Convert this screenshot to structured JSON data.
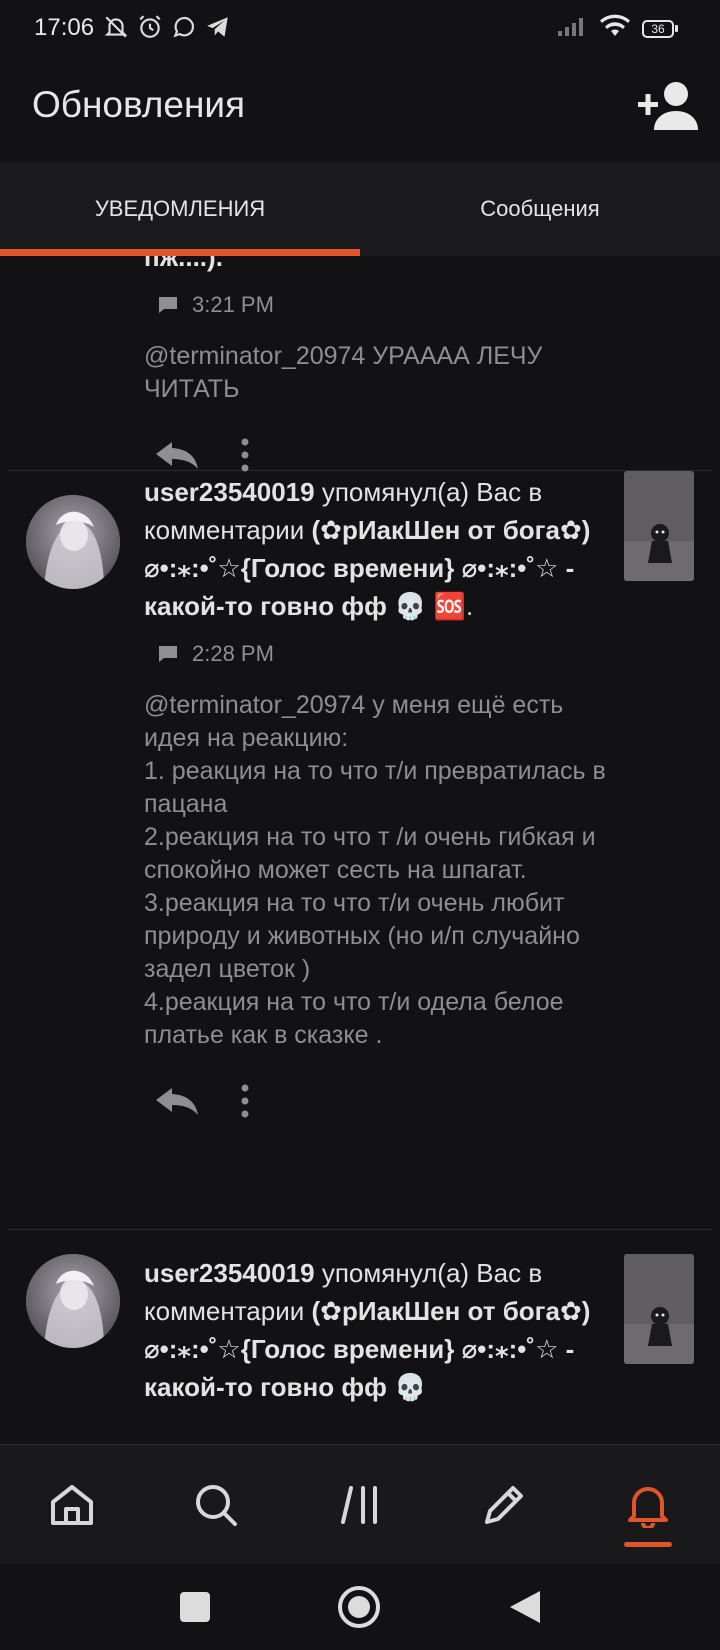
{
  "status_bar": {
    "time": "17:06",
    "battery": "36",
    "icons": [
      "bell-muted-icon",
      "alarm-icon",
      "whatsapp-icon",
      "telegram-icon",
      "signal-icon",
      "wifi-icon",
      "battery-icon"
    ]
  },
  "header": {
    "title": "Обновления",
    "add_user_icon": "add-user-icon"
  },
  "tabs": [
    {
      "label": "УВЕДОМЛЕНИЯ",
      "active": true
    },
    {
      "label": "Сообщения",
      "active": false
    }
  ],
  "colors": {
    "accent": "#e0562a",
    "background": "#121114",
    "text_primary": "#e3e3e3",
    "text_secondary": "#8e8d91"
  },
  "feed": {
    "partial": {
      "title_tail": "пж....).",
      "time": "3:21 PM",
      "comment": "@terminator_20974 УРАААА ЛЕЧУ ЧИТАТЬ"
    },
    "items": [
      {
        "user": "user23540019",
        "action": "упомянул(а) Вас в комментарии",
        "work": "(✿рИакШен от бога✿) ⌀•:⁎:•˚☆{Голос времени} ⌀•:⁎:•˚☆ - какой-то говно фф 💀 🆘",
        "end": ".",
        "time": "2:28 PM",
        "comment": "@terminator_20974 у меня ещё есть идея на реакцию:\n1. реакция на то что т/и превратилась в пацана\n2.реакция на то что т /и очень гибкая и спокойно может сесть на шпагат.\n3.реакция на то что т/и очень любит природу и животных (но и/п случайно задел цветок )\n4.реакция на то что т/и одела белое платье как в сказке ."
      },
      {
        "user": "user23540019",
        "action": "упомянул(а) Вас в комментарии",
        "work": "(✿рИакШен от бога✿) ⌀•:⁎:•˚☆{Голос времени} ⌀•:⁎:•˚☆ - какой-то говно фф 💀"
      }
    ]
  },
  "bottom_nav": [
    {
      "icon": "home-icon"
    },
    {
      "icon": "search-icon"
    },
    {
      "icon": "library-icon"
    },
    {
      "icon": "pencil-icon"
    },
    {
      "icon": "bell-icon",
      "active": true
    }
  ],
  "system_nav": [
    "recents-square-icon",
    "home-circle-icon",
    "back-triangle-icon"
  ]
}
